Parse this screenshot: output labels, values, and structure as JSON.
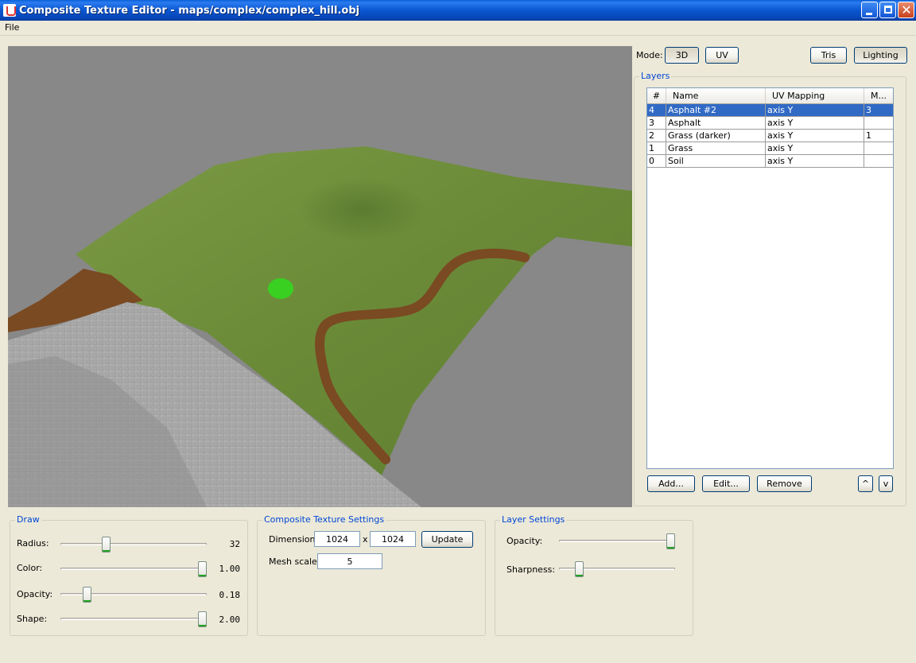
{
  "window": {
    "title": "Composite Texture Editor - maps/complex/complex_hill.obj"
  },
  "menu": {
    "file": "File"
  },
  "toolbar": {
    "mode_label": "Mode:",
    "mode_3d": "3D",
    "mode_uv": "UV",
    "tris": "Tris",
    "lighting": "Lighting"
  },
  "layers": {
    "title": "Layers",
    "columns": [
      "#",
      "Name",
      "UV Mapping",
      "M..."
    ],
    "rows": [
      {
        "num": "4",
        "name": "Asphalt #2",
        "uv": "axis Y",
        "m": "3",
        "selected": true
      },
      {
        "num": "3",
        "name": "Asphalt",
        "uv": "axis Y",
        "m": ""
      },
      {
        "num": "2",
        "name": "Grass (darker)",
        "uv": "axis Y",
        "m": "1"
      },
      {
        "num": "1",
        "name": "Grass",
        "uv": "axis Y",
        "m": ""
      },
      {
        "num": "0",
        "name": "Soil",
        "uv": "axis Y",
        "m": ""
      }
    ],
    "add": "Add...",
    "edit": "Edit...",
    "remove": "Remove",
    "up": "^",
    "down": "v"
  },
  "draw": {
    "title": "Draw",
    "radius_label": "Radius:",
    "radius_value": "32",
    "radius_fraction": 0.31,
    "color_label": "Color:",
    "color_value": "1.00",
    "color_fraction": 1.0,
    "opacity_label": "Opacity:",
    "opacity_value": "0.18",
    "opacity_fraction": 0.18,
    "shape_label": "Shape:",
    "shape_value": "2.00",
    "shape_fraction": 1.0
  },
  "composite": {
    "title": "Composite Texture Settings",
    "dimension_label": "Dimension:",
    "dim_w": "1024",
    "dim_x": "x",
    "dim_h": "1024",
    "update": "Update",
    "mesh_scale_label": "Mesh scale:",
    "mesh_scale": "5"
  },
  "layer_settings": {
    "title": "Layer Settings",
    "opacity_label": "Opacity:",
    "opacity_fraction": 1.0,
    "sharpness_label": "Sharpness:",
    "sharpness_fraction": 0.17
  },
  "colors": {
    "titlebar": "#0a56d0",
    "selection": "#316ac5",
    "group_title": "#0046d5",
    "viewport_bg": "#888888",
    "grass": "#6f8e3c",
    "soil": "#7a4a22",
    "asphalt": "#a4a4a4",
    "brush": "#39d022"
  }
}
